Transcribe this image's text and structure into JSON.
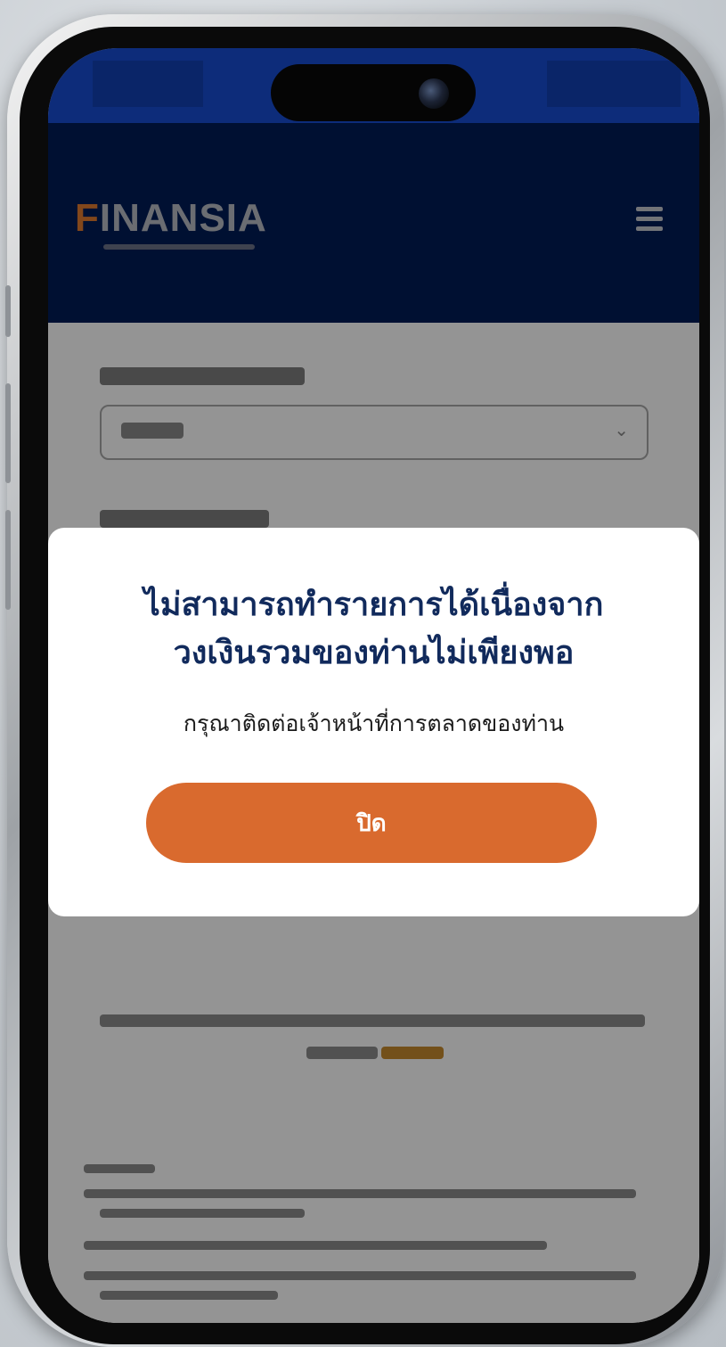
{
  "app": {
    "brand": {
      "logo_first": "F",
      "logo_rest": "INANSIA"
    }
  },
  "dialog": {
    "title_line1": "ไม่สามารถทำรายการได้เนื่องจาก",
    "title_line2": "วงเงินรวมของท่านไม่เพียงพอ",
    "message": "กรุณาติดต่อเจ้าหน้าที่การตลาดของท่าน",
    "close_label": "ปิด"
  },
  "colors": {
    "header_bg": "#001c57",
    "status_bar_bg": "#0d2c7a",
    "primary_button": "#d96a2e",
    "dialog_title": "#112a5c"
  },
  "icons": {
    "menu": "hamburger-menu-icon",
    "select": "chevron-down-icon",
    "camera": "front-camera-icon"
  }
}
